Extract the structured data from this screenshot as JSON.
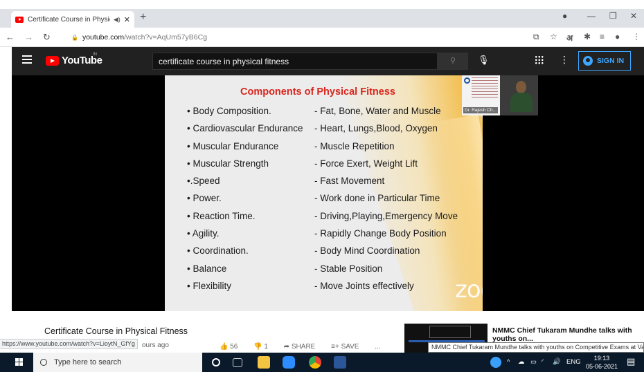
{
  "browser": {
    "tab_title": "Certificate Course in Physica",
    "tab_audio_icon": "speaker-icon",
    "new_tab": "+",
    "url_host": "youtube.com",
    "url_path": "/watch?v=AqUm57yB6Cg"
  },
  "youtube": {
    "logo_text": "YouTube",
    "country_code": "IN",
    "search_value": "certificate course in physical fitness",
    "sign_in_label": "SIGN IN"
  },
  "slide": {
    "title": "Components of Physical  Fitness",
    "rows": [
      {
        "component": "• Body Composition.",
        "description": "-  Fat, Bone, Water and Muscle"
      },
      {
        "component": "• Cardiovascular Endurance",
        "description": "- Heart, Lungs,Blood, Oxygen"
      },
      {
        "component": "• Muscular Endurance",
        "description": "-  Muscle Repetition"
      },
      {
        "component": "• Muscular Strength",
        "description": "-  Force Exert, Weight Lift"
      },
      {
        "component": "•.Speed",
        "description": "-  Fast Movement"
      },
      {
        "component": "• Power.",
        "description": "-  Work done in Particular Time"
      },
      {
        "component": "• Reaction Time.",
        "description": "-  Driving,Playing,Emergency Move"
      },
      {
        "component": "• Agility.",
        "description": "-  Rapidly Change Body Position"
      },
      {
        "component": "• Coordination.",
        "description": "-  Body Mind Coordination"
      },
      {
        "component": "• Balance",
        "description": "- Stable Position"
      },
      {
        "component": "• Flexibility",
        "description": "- Move Joints effectively"
      }
    ],
    "watermark": "zoom",
    "presenter_name": "Dr. Rajesh Ch..."
  },
  "video_info": {
    "title": "Certificate Course in Physical Fitness",
    "likes": "56",
    "dislikes": "1",
    "share_label": "SHARE",
    "save_label": "SAVE",
    "more_label": "...",
    "age_fragment": "ours ago"
  },
  "status_url": "https://www.youtube.com/watch?v=LioytN_GfYg",
  "up_next": {
    "title": "NMMC Chief Tukaram Mundhe talks with youths on...",
    "tooltip": "NMMC Chief Tukaram Mundhe talks with youths on Competitive Exams at Vashi"
  },
  "taskbar": {
    "search_placeholder": "Type here to search",
    "language": "ENG",
    "time": "19:13",
    "date": "05-06-2021"
  },
  "colors": {
    "youtube_red": "#ff0000",
    "slide_title_red": "#d9251c",
    "signin_blue": "#3ea6ff",
    "masthead_dark": "#212121"
  }
}
